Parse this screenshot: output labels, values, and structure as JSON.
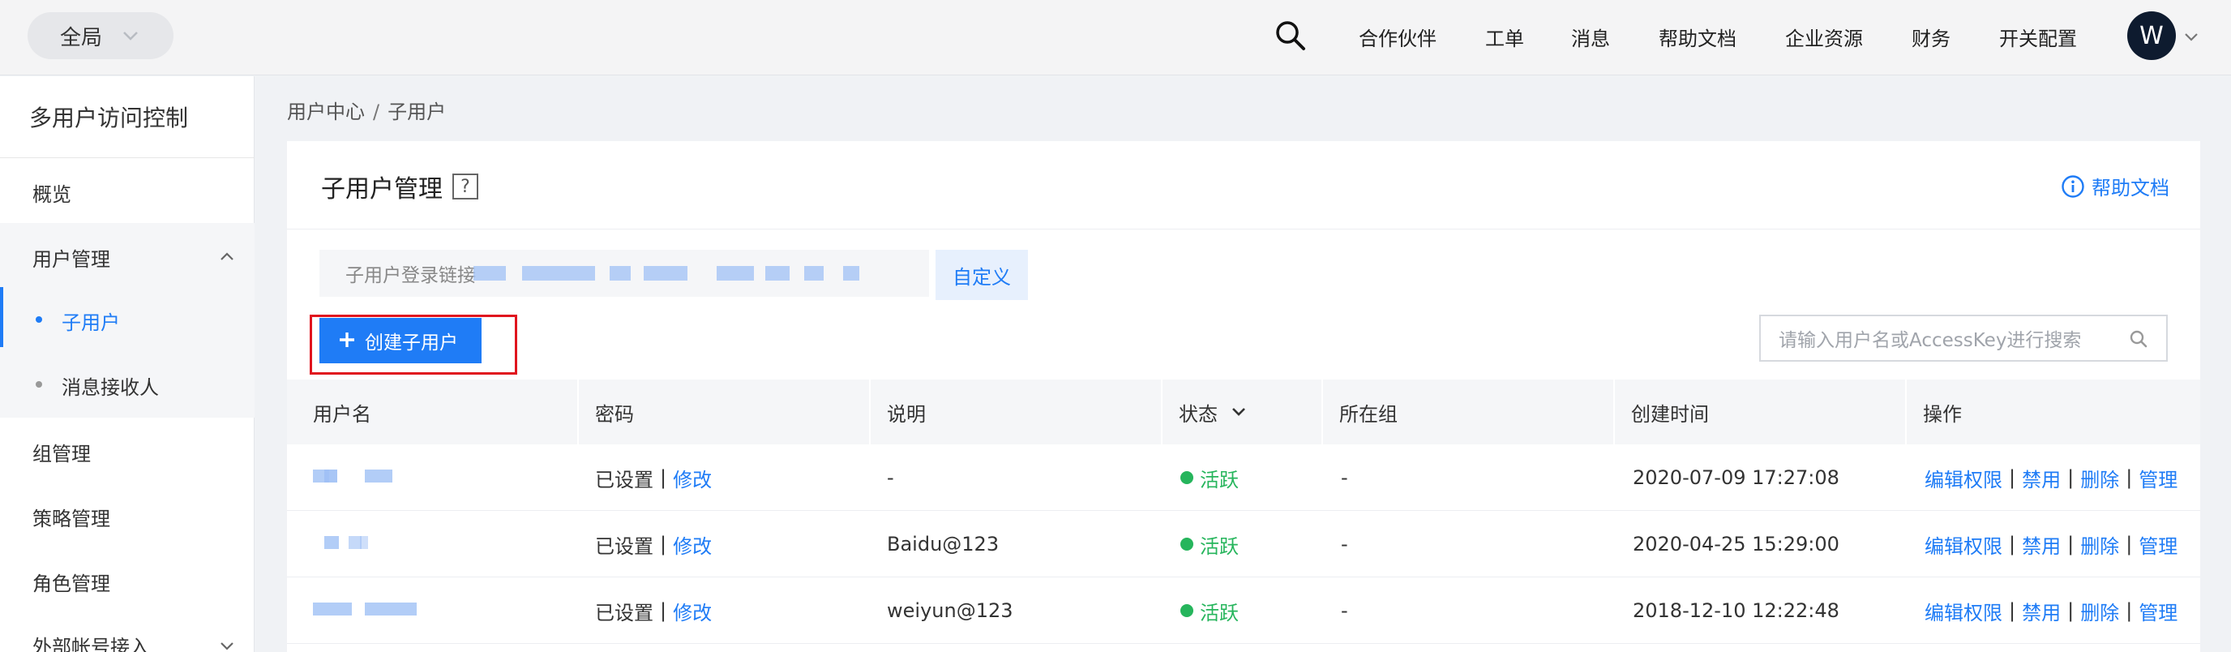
{
  "topbar": {
    "scope": "全局",
    "nav": [
      "合作伙伴",
      "工单",
      "消息",
      "帮助文档",
      "企业资源",
      "财务",
      "开关配置"
    ],
    "avatar": "W"
  },
  "sidebar": {
    "title": "多用户访问控制",
    "items": {
      "overview": "概览",
      "user_mgmt": "用户管理",
      "sub_user": "子用户",
      "msg_receiver": "消息接收人",
      "group_mgmt": "组管理",
      "policy_mgmt": "策略管理",
      "role_mgmt": "角色管理",
      "external": "外部帐号接入"
    }
  },
  "breadcrumb": {
    "root": "用户中心",
    "sep": "/",
    "current": "子用户"
  },
  "panel": {
    "title": "子用户管理",
    "qmark": "?",
    "help": "帮助文档",
    "login_label": "子用户登录链接",
    "customize": "自定义",
    "create": "创建子用户",
    "search_placeholder": "请输入用户名或AccessKey进行搜索"
  },
  "table": {
    "headers": [
      "用户名",
      "密码",
      "说明",
      "状态",
      "所在组",
      "创建时间",
      "操作"
    ],
    "rows": [
      {
        "password": "已设置",
        "edit": "修改",
        "desc": "-",
        "status": "活跃",
        "group": "-",
        "created": "2020-07-09 17:27:08"
      },
      {
        "password": "已设置",
        "edit": "修改",
        "desc": "Baidu@123",
        "status": "活跃",
        "group": "-",
        "created": "2020-04-25 15:29:00"
      },
      {
        "password": "已设置",
        "edit": "修改",
        "desc": "weiyun@123",
        "status": "活跃",
        "group": "-",
        "created": "2018-12-10 12:22:48"
      }
    ],
    "actions": {
      "edit_perm": "编辑权限",
      "disable": "禁用",
      "delete": "删除",
      "manage": "管理",
      "sep": "|"
    }
  },
  "colors": {
    "accent": "#1f7cf6",
    "active": "#26b55c",
    "highlight": "#e0141e"
  },
  "icons": [
    "chevron-down-icon",
    "search-icon",
    "chevron-up-icon",
    "help-icon",
    "info-icon",
    "plus-icon",
    "magnifier-icon"
  ]
}
